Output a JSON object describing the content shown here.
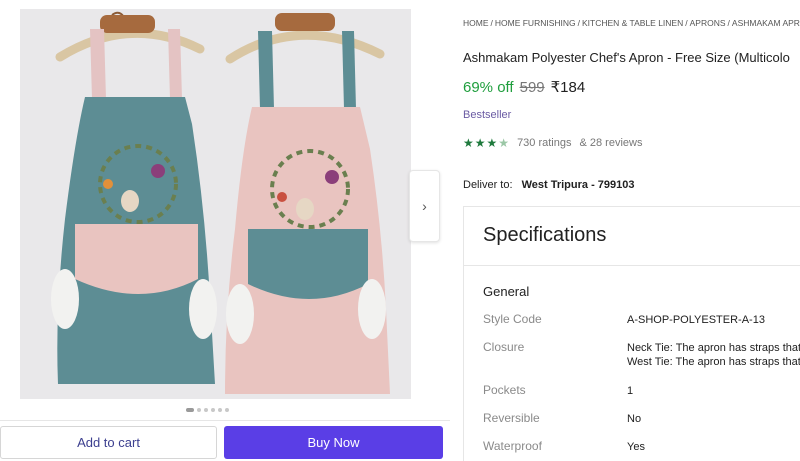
{
  "breadcrumb": [
    "HOME",
    "HOME FURNISHING",
    "KITCHEN & TABLE LINEN",
    "APRONS",
    "ASHMAKAM APRONS"
  ],
  "breadcrumb_separator": "/",
  "product": {
    "title": "Ashmakam Polyester Chef's Apron - Free Size (Multicolo",
    "discount": "69% off",
    "mrp": "599",
    "price": "₹184",
    "badge": "Bestseller",
    "rating_stars": 3.5,
    "ratings": "730 ratings",
    "reviews": "& 28 reviews"
  },
  "delivery": {
    "label": "Deliver to:",
    "location": "West Tripura - 799103"
  },
  "carousel": {
    "next_icon": "chevron-right-icon",
    "dot_count": 6,
    "active_dot": 0
  },
  "actions": {
    "add_to_cart": "Add to cart",
    "buy_now": "Buy Now"
  },
  "specifications": {
    "heading": "Specifications",
    "group": "General",
    "rows": [
      {
        "label": "Style Code",
        "value": [
          "A-SHOP-POLYESTER-A-13"
        ]
      },
      {
        "label": "Closure",
        "value": [
          "Neck Tie: The apron has straps that",
          "West Tie: The apron has straps that"
        ]
      },
      {
        "label": "Pockets",
        "value": [
          "1"
        ]
      },
      {
        "label": "Reversible",
        "value": [
          "No"
        ]
      },
      {
        "label": "Waterproof",
        "value": [
          "Yes"
        ]
      }
    ]
  },
  "colors": {
    "discount": "#1f9e3d",
    "buy_button": "#5a3ee6",
    "stars": "#1f7a3d",
    "badge": "#6a5ba3"
  }
}
